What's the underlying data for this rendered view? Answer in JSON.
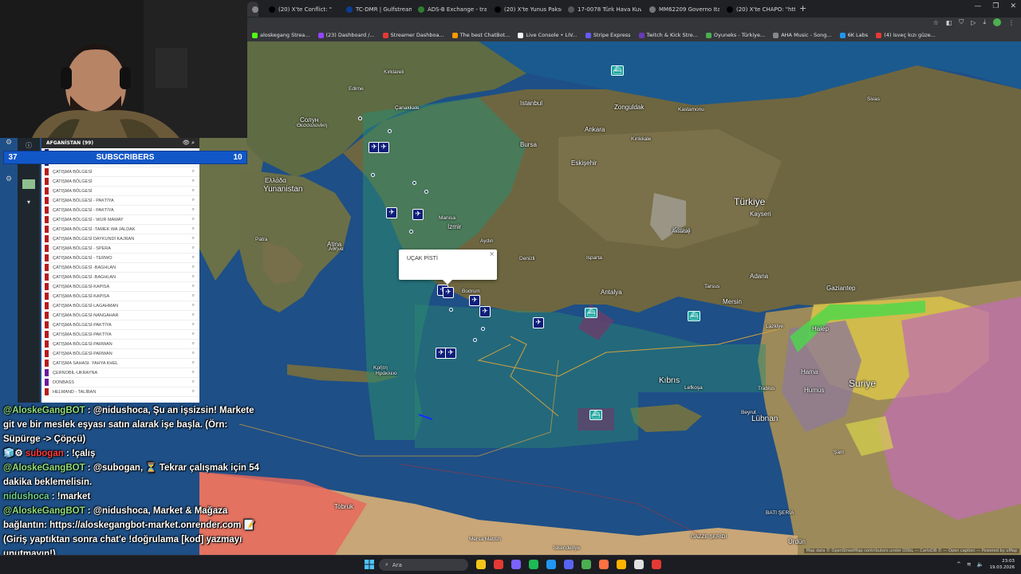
{
  "browser": {
    "tabs": [
      {
        "label": "",
        "color": "#888"
      },
      {
        "label": "(20) X'te Conflict: \"🚨 SO",
        "color": "#000"
      },
      {
        "label": "TC-DMR | Gulfstream G-I",
        "color": "#0b3d91"
      },
      {
        "label": "ADS-B Exchange - track a",
        "color": "#2e7d32"
      },
      {
        "label": "(20) X'te Yunus Paksoy: \"",
        "color": "#000"
      },
      {
        "label": "17-0078 Türk Hava Kuvvet",
        "color": "#555"
      },
      {
        "label": "MM62209 Governo Italian",
        "color": "#777"
      },
      {
        "label": "(20) X'te CHAPO: \"https://",
        "color": "#000"
      }
    ],
    "new_tab": "+",
    "window_controls": [
      "—",
      "❐",
      "✕"
    ],
    "bookmarks": [
      {
        "label": "aloskegang Strea...",
        "color": "#53fc18"
      },
      {
        "label": "(23) Dashboard /...",
        "color": "#9146ff"
      },
      {
        "label": "Streamer Dashboa...",
        "color": "#e53935"
      },
      {
        "label": "The best ChatBot...",
        "color": "#ff9800"
      },
      {
        "label": "Live Console • LIV...",
        "color": "#f5f5f5"
      },
      {
        "label": "Stripe Express",
        "color": "#635bff"
      },
      {
        "label": "Twitch & Kick Stre...",
        "color": "#673ab7"
      },
      {
        "label": "Oyuneks - Türkiye...",
        "color": "#4caf50"
      },
      {
        "label": "AHA Music - Song...",
        "color": "#888"
      },
      {
        "label": "6K Labs",
        "color": "#2196f3"
      },
      {
        "label": "(4) isveç kızı güze...",
        "color": "#e53935"
      }
    ]
  },
  "map": {
    "popup_title": "UÇAK PİSTİ",
    "popup_close": "×",
    "attribution": "Map data © OpenStreetMap contributors under ODbL — CartoDB © — Open caption — Powered by uMap",
    "labels": [
      {
        "text": "Türkiye",
        "cls": "huge"
      },
      {
        "text": "Suriye",
        "cls": "huge"
      },
      {
        "text": "Kıbrıs",
        "cls": "big"
      },
      {
        "text": "Lübnan",
        "cls": "big"
      },
      {
        "text": "Ελλάδα",
        "cls": ""
      },
      {
        "text": "Yunanistan",
        "cls": "big"
      },
      {
        "text": "Istanbul",
        "cls": ""
      },
      {
        "text": "Ankara",
        "cls": ""
      },
      {
        "text": "Bursa",
        "cls": ""
      },
      {
        "text": "Eskişehir",
        "cls": ""
      },
      {
        "text": "İzmir",
        "cls": ""
      },
      {
        "text": "Antalya",
        "cls": ""
      },
      {
        "text": "Konya",
        "cls": ""
      },
      {
        "text": "Kayseri",
        "cls": ""
      },
      {
        "text": "Mersin",
        "cls": ""
      },
      {
        "text": "Adana",
        "cls": ""
      },
      {
        "text": "Gaziantep",
        "cls": ""
      },
      {
        "text": "Halep",
        "cls": ""
      },
      {
        "text": "Hama",
        "cls": ""
      },
      {
        "text": "Humus",
        "cls": ""
      },
      {
        "text": "Atina",
        "cls": ""
      },
      {
        "text": "Αθήνα",
        "cls": "small"
      },
      {
        "text": "Солун",
        "cls": ""
      },
      {
        "text": "Θεσσαλονίκη",
        "cls": "small"
      },
      {
        "text": "Zonguldak",
        "cls": ""
      },
      {
        "text": "Kırıkkale",
        "cls": "small"
      },
      {
        "text": "Kastamonu",
        "cls": "small"
      },
      {
        "text": "Tobruk",
        "cls": ""
      },
      {
        "text": "BATI ŞERİA",
        "cls": "small"
      },
      {
        "text": "GAZZE ŞERİDİ",
        "cls": "small"
      },
      {
        "text": "Ürdün",
        "cls": ""
      },
      {
        "text": "Denizli",
        "cls": "small"
      },
      {
        "text": "Manisa",
        "cls": "small"
      },
      {
        "text": "Aydın",
        "cls": "small"
      },
      {
        "text": "Isparta",
        "cls": "small"
      },
      {
        "text": "Bodrum",
        "cls": "small"
      },
      {
        "text": "Kırklareli",
        "cls": "small"
      },
      {
        "text": "Çanakkale",
        "cls": "small"
      },
      {
        "text": "Edirne",
        "cls": "small"
      },
      {
        "text": "Sivas",
        "cls": "small"
      },
      {
        "text": "Aksaray",
        "cls": "small"
      },
      {
        "text": "Patra",
        "cls": "small"
      },
      {
        "text": "Κρήτη",
        "cls": "small"
      },
      {
        "text": "Ηράκλειο",
        "cls": "small"
      },
      {
        "text": "Tarsus",
        "cls": "small"
      },
      {
        "text": "Lazkiye",
        "cls": "small"
      },
      {
        "text": "Trablus",
        "cls": "small"
      },
      {
        "text": "Beyrut",
        "cls": "small"
      },
      {
        "text": "Şam",
        "cls": "small"
      },
      {
        "text": "Lefkoşa",
        "cls": "small"
      },
      {
        "text": "Mersa Matruh",
        "cls": "small"
      },
      {
        "text": "İskenderiye",
        "cls": "small"
      }
    ]
  },
  "layer_panel": {
    "header": "AFGANİSTAN (99)",
    "rows": [
      {
        "label": "",
        "color": "#1a237e"
      },
      {
        "label": "Askeri Bölge",
        "color": "#1a237e"
      },
      {
        "label": "ÇATIŞMA BÖLGESİ",
        "color": "#b71c1c"
      },
      {
        "label": "ÇATIŞMA BÖLGESİ",
        "color": "#b71c1c"
      },
      {
        "label": "ÇATIŞMA BÖLGESİ",
        "color": "#b71c1c"
      },
      {
        "label": "ÇATIŞMA BÖLGESİ - PAKTİYA",
        "color": "#b71c1c"
      },
      {
        "label": "ÇATIŞMA BÖLGESİ - PAKTİYA",
        "color": "#b71c1c"
      },
      {
        "label": "ÇATIŞMA BÖLGESİ - WUR MAMAY",
        "color": "#b71c1c"
      },
      {
        "label": "ÇATIŞMA BÖLGESİ -TAMEK WA JALDAK",
        "color": "#b71c1c"
      },
      {
        "label": "ÇATIŞMA BÖLGESİ DAYKUNDİ KAJRAN",
        "color": "#b71c1c"
      },
      {
        "label": "ÇATIŞMA BÖLGESİ - SPERA",
        "color": "#b71c1c"
      },
      {
        "label": "ÇATIŞMA BÖLGESİ - TERWO",
        "color": "#b71c1c"
      },
      {
        "label": "ÇATIŞMA BÖLGESİ -BAGHLAN",
        "color": "#b71c1c"
      },
      {
        "label": "ÇATIŞMA BÖLGESİ -BAGHLAN",
        "color": "#b71c1c"
      },
      {
        "label": "ÇATIŞMA BÖLGESİ-KAPISA",
        "color": "#b71c1c"
      },
      {
        "label": "ÇATIŞMA BÖLGESİ-KAPISA",
        "color": "#b71c1c"
      },
      {
        "label": "ÇATIŞMA BÖLGESİ-LAGAHMAN",
        "color": "#b71c1c"
      },
      {
        "label": "ÇATIŞMA BÖLGESİ-NANGAHAR",
        "color": "#b71c1c"
      },
      {
        "label": "ÇATIŞMA BÖLGESİ-PAKTİYA",
        "color": "#b71c1c"
      },
      {
        "label": "ÇATIŞMA BÖLGESİ-PAKTİYA",
        "color": "#b71c1c"
      },
      {
        "label": "ÇATIŞMA BÖLGESİ-PARWAN",
        "color": "#b71c1c"
      },
      {
        "label": "ÇATIŞMA BÖLGESİ-PARWAN",
        "color": "#b71c1c"
      },
      {
        "label": "ÇATIŞMA SAHASI- YAHYA KHEL",
        "color": "#b71c1c"
      },
      {
        "label": "ÇERNOBİL-UKRAYNA",
        "color": "#6a1b9a"
      },
      {
        "label": "DONBASS",
        "color": "#6a1b9a"
      },
      {
        "label": "HELMAND - TALİBAN",
        "color": "#b71c1c"
      }
    ]
  },
  "subscribers": {
    "left_count": "37",
    "title": "SUBSCRIBERS",
    "right_count": "10",
    "bar_color": "#1257c8"
  },
  "chat": {
    "messages": [
      {
        "user": "@AloskeGangBOT",
        "user_class": "user-bot",
        "text": " : @nidushoca, Şu an işsizsin! Markete git ve bir meslek eşyası satın alarak işe başla. (Örn: Süpürge -> Çöpçü)"
      },
      {
        "user": "subogan",
        "user_class": "user-s",
        "prefix": "🧊⚙ ",
        "text": " : !çalış"
      },
      {
        "user": "@AloskeGangBOT",
        "user_class": "user-bot",
        "text": " : @subogan, ⏳ Tekrar çalışmak için 54 dakika beklemelisin."
      },
      {
        "user": "nidushoca",
        "user_class": "user-n",
        "text": " : !market"
      },
      {
        "user": "@AloskeGangBOT",
        "user_class": "user-bot",
        "text": " : @nidushoca, Market & Mağaza bağlantın: https://aloskegangbot-market.onrender.com 📝 (Giriş yaptıktan sonra chat'e !doğrulama [kod] yazmayı unutmayın!)"
      }
    ]
  },
  "taskbar": {
    "search_placeholder": "Ara",
    "apps": [
      "#f5c518",
      "#e53935",
      "#7b61ff",
      "#1db954",
      "#2196f3",
      "#5865f2",
      "#4caf50",
      "#ff7043",
      "#ffb300",
      "#e0e0e0",
      "#e53935"
    ],
    "time": "23:03",
    "date": "19.03.2026"
  }
}
